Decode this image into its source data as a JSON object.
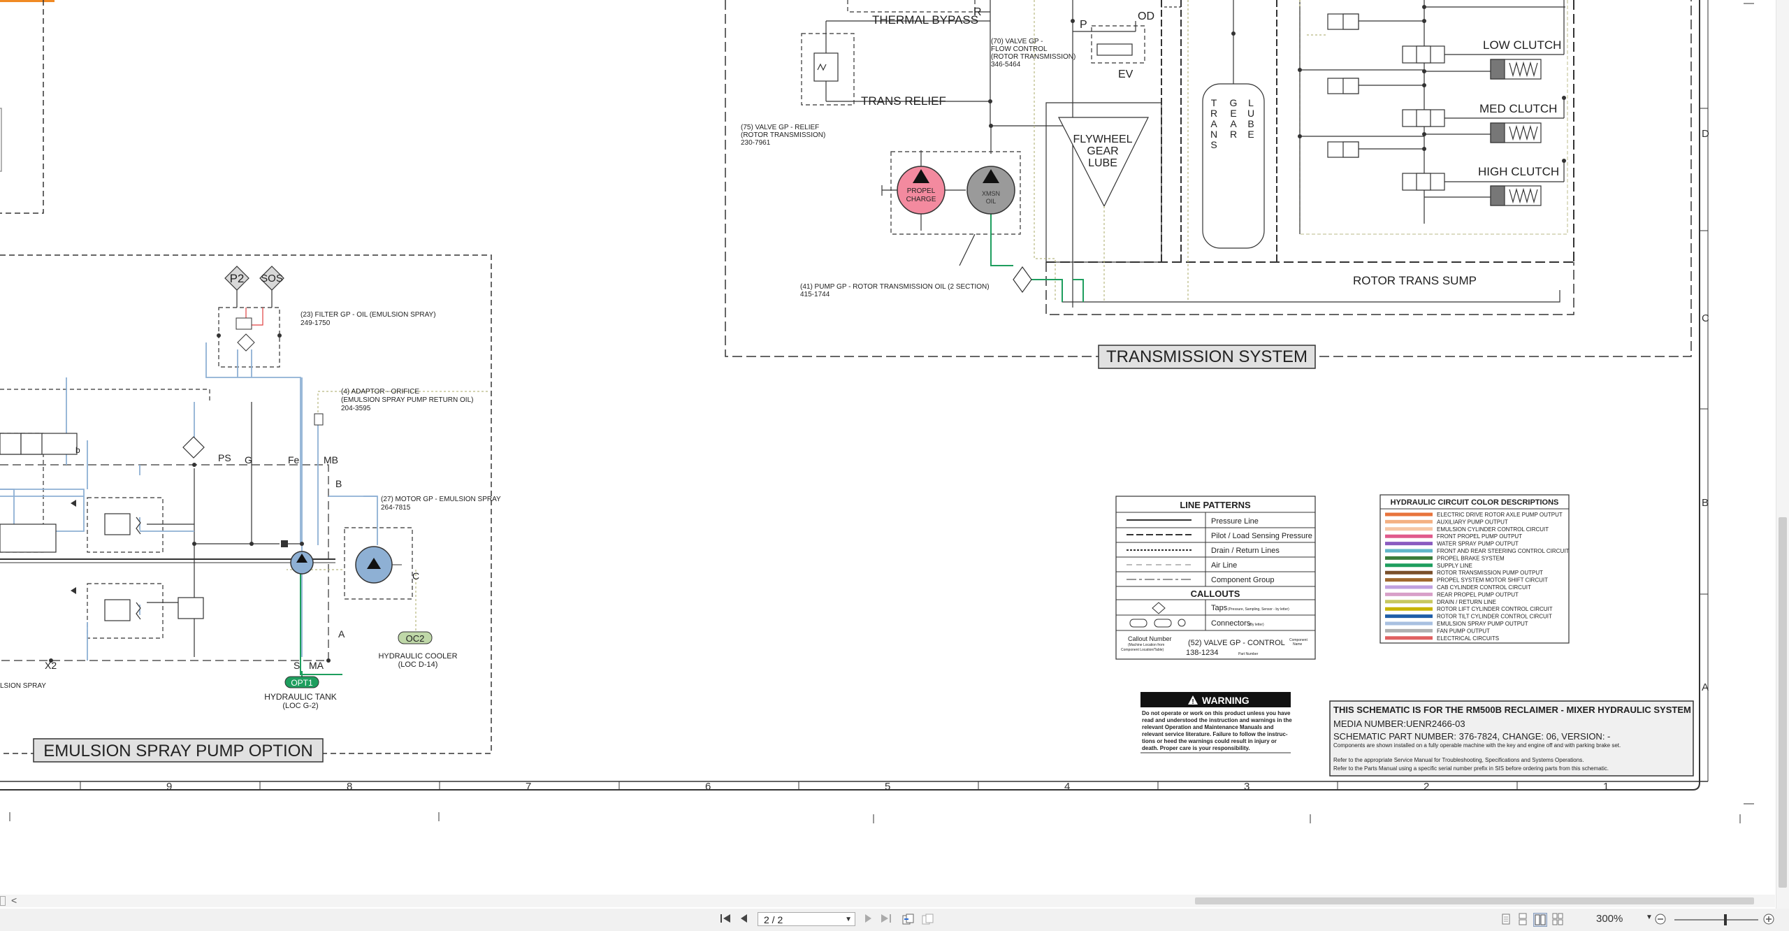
{
  "viewer": {
    "page_display": "2 / 2",
    "zoom": "300%",
    "scroll_left_arrow": "<"
  },
  "schematic": {
    "thermal_bypass": "THERMAL BYPASS",
    "r_label": "R",
    "trans_relief": "TRANS RELIEF",
    "valve_relief_1": "(75) VALVE GP - RELIEF",
    "valve_relief_2": "(ROTOR TRANSMISSION)",
    "valve_relief_3": "230-7961",
    "flow_valve_1": "(70) VALVE GP -",
    "flow_valve_2": "FLOW CONTROL",
    "flow_valve_3": "(ROTOR TRANSMISSION)",
    "flow_valve_4": "346-5464",
    "p_label": "P",
    "od_label": "OD",
    "ev_label": "EV",
    "flywheel_1": "FLYWHEEL",
    "flywheel_2": "GEAR",
    "flywheel_3": "LUBE",
    "trans_col": [
      "T",
      "R",
      "A",
      "N",
      "S"
    ],
    "gear_col": [
      "G",
      "E",
      "A",
      "R"
    ],
    "lube_col": [
      "L",
      "U",
      "B",
      "E"
    ],
    "low_clutch": "LOW CLUTCH",
    "med_clutch": "MED CLUTCH",
    "high_clutch": "HIGH CLUTCH",
    "propel_charge_1": "PROPEL",
    "propel_charge_2": "CHARGE",
    "xmsn_oil_1": "XMSN",
    "xmsn_oil_2": "OIL",
    "pump_rotor_1": "(41) PUMP GP - ROTOR TRANSMISSION OIL (2 SECTION)",
    "pump_rotor_2": "415-1744",
    "rotor_trans_sump": "ROTOR TRANS SUMP",
    "transmission_system": "TRANSMISSION SYSTEM",
    "p2": "P2",
    "sos": "SOS",
    "filter_1": "(23) FILTER GP - OIL (EMULSION SPRAY)",
    "filter_2": "249-1750",
    "adaptor_1": "(4) ADAPTOR - ORIFICE",
    "adaptor_2": "(EMULSION SPRAY PUMP RETURN OIL)",
    "adaptor_3": "204-3595",
    "motor_1": "(27) MOTOR GP - EMULSION SPRAY",
    "motor_2": "264-7815",
    "ps": "PS",
    "g": "G",
    "fe": "Fe",
    "mb": "MB",
    "b": "B",
    "a": "A",
    "c": "C",
    "s": "S",
    "ma": "MA",
    "x2": "X2",
    "b_small": "b",
    "opt1": "OPT1",
    "hyd_tank_1": "HYDRAULIC TANK",
    "hyd_tank_2": "(LOC G-2)",
    "oc2": "OC2",
    "hyd_cooler_1": "HYDRAULIC COOLER",
    "hyd_cooler_2": "(LOC D-14)",
    "emulsion_spray_frag": "LSION SPRAY",
    "emulsion_spray_option": "EMULSION SPRAY PUMP OPTION",
    "line_patterns_title": "LINE PATTERNS",
    "line_patterns": [
      "Pressure Line",
      "Pilot / Load Sensing Pressure",
      "Drain / Return Lines",
      "Air Line",
      "Component Group"
    ],
    "callouts_title": "CALLOUTS",
    "taps": "Taps",
    "taps_note": "(Pressure, Sampling, Sensor - by letter)",
    "connectors": "Connectors",
    "connectors_note": "(By letter)",
    "callout_number": "Callout Number",
    "callout_number_note_1": "(Machine Location from",
    "callout_number_note_2": "Component Location/Table)",
    "callout_example": "(52) VALVE GP - CONTROL",
    "callout_part": "138-1234",
    "callout_component_name_1": "Component",
    "callout_component_name_2": "Name",
    "callout_part_number": "Part Number",
    "color_desc_title": "HYDRAULIC CIRCUIT COLOR DESCRIPTIONS",
    "color_desc": [
      {
        "label": "ELECTRIC DRIVE ROTOR AXLE PUMP OUTPUT",
        "color": "#e8743c"
      },
      {
        "label": "AUXILIARY PUMP OUTPUT",
        "color": "#f4b183"
      },
      {
        "label": "EMULSION CYLINDER CONTROL CIRCUIT",
        "color": "#f6c6a4"
      },
      {
        "label": "FRONT PROPEL PUMP OUTPUT",
        "color": "#e05a8c"
      },
      {
        "label": "WATER SPRAY PUMP OUTPUT",
        "color": "#8a5cc0"
      },
      {
        "label": "FRONT AND REAR STEERING CONTROL CIRCUIT",
        "color": "#60b7c8"
      },
      {
        "label": "PROPEL BRAKE SYSTEM",
        "color": "#3a7c3a"
      },
      {
        "label": "SUPPLY LINE",
        "color": "#1e9e5e"
      },
      {
        "label": "ROTOR TRANSMISSION PUMP OUTPUT",
        "color": "#7a4f2a"
      },
      {
        "label": "PROPEL SYSTEM MOTOR SHIFT CIRCUIT",
        "color": "#a0682e"
      },
      {
        "label": "CAB CYLINDER CONTROL CIRCUIT",
        "color": "#c0a0e0"
      },
      {
        "label": "REAR PROPEL PUMP OUTPUT",
        "color": "#d8a0c8"
      },
      {
        "label": "DRAIN / RETURN LINE",
        "color": "#c8c860"
      },
      {
        "label": "ROTOR LIFT CYLINDER CONTROL CIRCUIT",
        "color": "#c8b400"
      },
      {
        "label": "ROTOR TILT CYLINDER CONTROL CIRCUIT",
        "color": "#1f5ea8"
      },
      {
        "label": "EMULSION SPRAY PUMP OUTPUT",
        "color": "#a8c0e0"
      },
      {
        "label": "FAN PUMP OUTPUT",
        "color": "#b0b0b0"
      },
      {
        "label": "ELECTRICAL CIRCUITS",
        "color": "#e06060"
      }
    ],
    "warning_title": "WARNING",
    "warning_lines": [
      "Do not operate or work on this product unless you have",
      "read and understood the instruction and warnings in the",
      "relevant Operation and Maintenance Manuals and",
      "relevant service literature. Failure to follow the instruc-",
      "tions or heed the warnings could result in injury or",
      "death. Proper care is your responsibility."
    ],
    "info_title": "THIS SCHEMATIC IS FOR THE RM500B RECLAIMER - MIXER HYDRAULIC SYSTEM",
    "info_media": "MEDIA NUMBER:UENR2466-03",
    "info_part": "SCHEMATIC PART NUMBER: 376-7824, CHANGE: 06, VERSION: -",
    "info_note": "Components are shown installed on a fully operable machine with the key and engine off and with parking brake set.",
    "info_ref_1": "Refer to the appropriate Service Manual for Troubleshooting, Specifications and Systems Operations.",
    "info_ref_2": "Refer to the Parts Manual using a specific serial number prefix in SIS before ordering parts from this schematic.",
    "grid_cols": [
      "9",
      "8",
      "7",
      "6",
      "5",
      "4",
      "3",
      "2",
      "1"
    ],
    "grid_rows": [
      "D",
      "C",
      "B",
      "A"
    ]
  }
}
